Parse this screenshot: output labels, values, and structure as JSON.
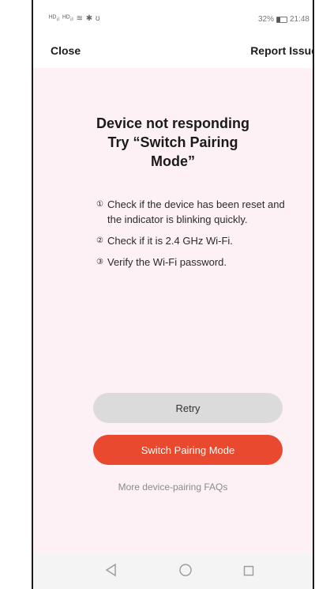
{
  "status_bar": {
    "left": "ᴴᴰᵢₗ ᴴᴰᵢₗ ≋ ✱ ʊ",
    "battery": "32%",
    "time": "21:48"
  },
  "header": {
    "close_label": "Close",
    "report_label": "Report Issue"
  },
  "main": {
    "title_line1": "Device not responding",
    "title_line2": "Try “Switch Pairing Mode”",
    "steps": [
      {
        "num": "①",
        "text": "Check if the device has been reset and the indicator is blinking quickly."
      },
      {
        "num": "②",
        "text": "Check if it is 2.4 GHz Wi-Fi."
      },
      {
        "num": "③",
        "text": "Verify the Wi-Fi password."
      }
    ]
  },
  "actions": {
    "retry_label": "Retry",
    "switch_label": "Switch Pairing Mode",
    "faq_label": "More device-pairing FAQs"
  },
  "colors": {
    "background": "#fdf1f5",
    "primary_button": "#e8492f",
    "secondary_button": "#dcdbdc"
  },
  "icons": {
    "nav_back": "triangle-back-icon",
    "nav_home": "circle-home-icon",
    "nav_recent": "square-recent-icon"
  }
}
